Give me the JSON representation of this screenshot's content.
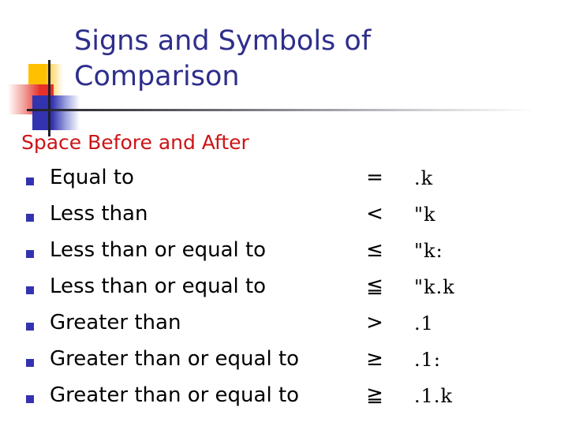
{
  "slide": {
    "title": "Signs and Symbols of Comparison",
    "subheading": "Space Before and After",
    "colors": {
      "title": "#2e2e8c",
      "subheading": "#cc1417",
      "bullet": "#3333b0",
      "body_text": "#000000",
      "decor_yellow": "#ffc000",
      "decor_red": "#e8302a",
      "decor_blue": "#3333b0",
      "divider": "#1f1f28"
    },
    "rows": [
      {
        "bullet": "square-bullet",
        "label": "Equal to",
        "symbol": "=",
        "code": ".k"
      },
      {
        "bullet": "square-bullet",
        "label": "Less than",
        "symbol": "<",
        "code": "\"k"
      },
      {
        "bullet": "square-bullet",
        "label": "Less than or equal to",
        "symbol": "≤",
        "code": "\"k:"
      },
      {
        "bullet": "square-bullet",
        "label": "Less than or equal to",
        "symbol": "≦",
        "code": "\"k.k"
      },
      {
        "bullet": "square-bullet",
        "label": "Greater than",
        "symbol": ">",
        "code": ".1"
      },
      {
        "bullet": "square-bullet",
        "label": "Greater than or equal to",
        "symbol": "≥",
        "code": ".1:"
      },
      {
        "bullet": "square-bullet",
        "label": "Greater than or equal to",
        "symbol": "≧",
        "code": ".1.k"
      }
    ]
  }
}
